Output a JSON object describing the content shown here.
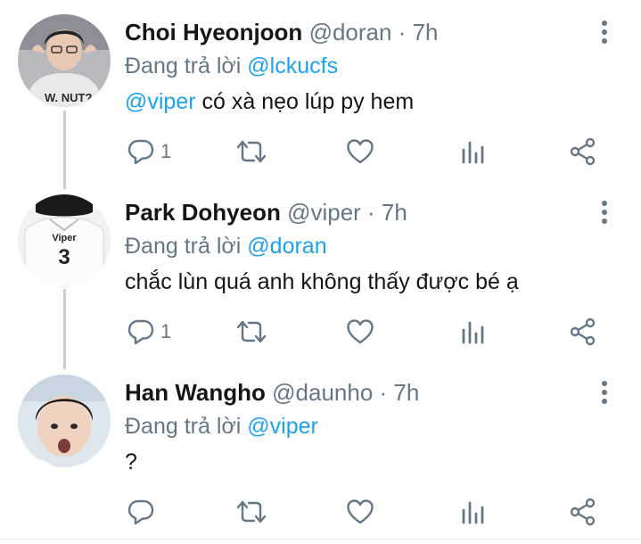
{
  "tweets": [
    {
      "name": "Choi Hyeonjoon",
      "handle": "@doran",
      "time": "7h",
      "reply_prefix": "Đang trả lời",
      "reply_to": "@lckucfs",
      "mention": "@viper",
      "text": " có xà nẹo lúp py hem",
      "reply_count": "1",
      "avatar_icon": "avatar-photo"
    },
    {
      "name": "Park Dohyeon",
      "handle": "@viper",
      "time": "7h",
      "reply_prefix": "Đang trả lời",
      "reply_to": "@doran",
      "mention": "",
      "text": "chắc lùn quá anh không thấy được bé ạ",
      "reply_count": "1",
      "avatar_icon": "avatar-photo",
      "avatar_jersey_name": "Viper",
      "avatar_jersey_number": "3"
    },
    {
      "name": "Han Wangho",
      "handle": "@daunho",
      "time": "7h",
      "reply_prefix": "Đang trả lời",
      "reply_to": "@viper",
      "mention": "",
      "text": "?",
      "reply_count": "",
      "avatar_icon": "avatar-photo"
    }
  ],
  "colors": {
    "accent": "#1da1f2",
    "muted": "#657786",
    "text": "#14171a",
    "thread_line": "#c4cfd6"
  },
  "icons": [
    "reply-icon",
    "retweet-icon",
    "like-icon",
    "analytics-icon",
    "share-icon",
    "more-icon"
  ]
}
